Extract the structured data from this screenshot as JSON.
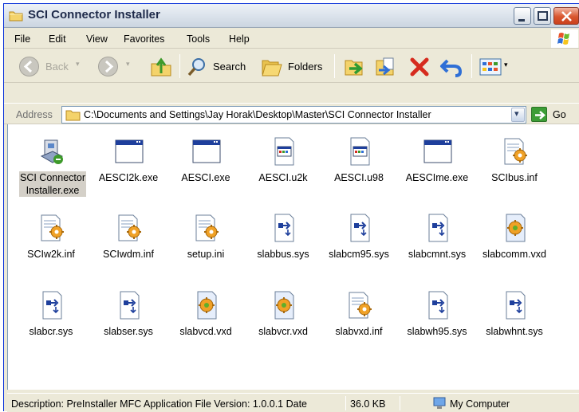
{
  "window": {
    "title": "SCI Connector Installer"
  },
  "menu": [
    "File",
    "Edit",
    "View",
    "Favorites",
    "Tools",
    "Help"
  ],
  "toolbar": {
    "back_label": "Back",
    "search_label": "Search",
    "folders_label": "Folders"
  },
  "address": {
    "label": "Address",
    "path": "C:\\Documents and Settings\\Jay Horak\\Desktop\\Master\\SCI Connector Installer",
    "go_label": "Go"
  },
  "files": [
    {
      "name": "SCI Connector Installer.exe",
      "icon": "installer-icon",
      "selected": true
    },
    {
      "name": "AESCI2k.exe",
      "icon": "window-exe-icon"
    },
    {
      "name": "AESCI.exe",
      "icon": "window-exe-icon"
    },
    {
      "name": "AESCI.u2k",
      "icon": "document-app-icon"
    },
    {
      "name": "AESCI.u98",
      "icon": "document-app-icon"
    },
    {
      "name": "AESCIme.exe",
      "icon": "window-exe-icon"
    },
    {
      "name": "SCIbus.inf",
      "icon": "inf-gear-icon"
    },
    {
      "name": "SCIw2k.inf",
      "icon": "inf-gear-icon"
    },
    {
      "name": "SCIwdm.inf",
      "icon": "inf-gear-icon"
    },
    {
      "name": "setup.ini",
      "icon": "inf-gear-icon"
    },
    {
      "name": "slabbus.sys",
      "icon": "sys-file-icon"
    },
    {
      "name": "slabcm95.sys",
      "icon": "sys-file-icon"
    },
    {
      "name": "slabcmnt.sys",
      "icon": "sys-file-icon"
    },
    {
      "name": "slabcomm.vxd",
      "icon": "vxd-gear-icon"
    },
    {
      "name": "slabcr.sys",
      "icon": "sys-file-icon"
    },
    {
      "name": "slabser.sys",
      "icon": "sys-file-icon"
    },
    {
      "name": "slabvcd.vxd",
      "icon": "vxd-gear-icon"
    },
    {
      "name": "slabvcr.vxd",
      "icon": "vxd-gear-icon"
    },
    {
      "name": "slabvxd.inf",
      "icon": "inf-gear-icon"
    },
    {
      "name": "slabwh95.sys",
      "icon": "sys-file-icon"
    },
    {
      "name": "slabwhnt.sys",
      "icon": "sys-file-icon"
    }
  ],
  "status": {
    "description": "Description: PreInstaller MFC Application File Version: 1.0.0.1 Date",
    "size": "36.0 KB",
    "location": "My Computer"
  }
}
